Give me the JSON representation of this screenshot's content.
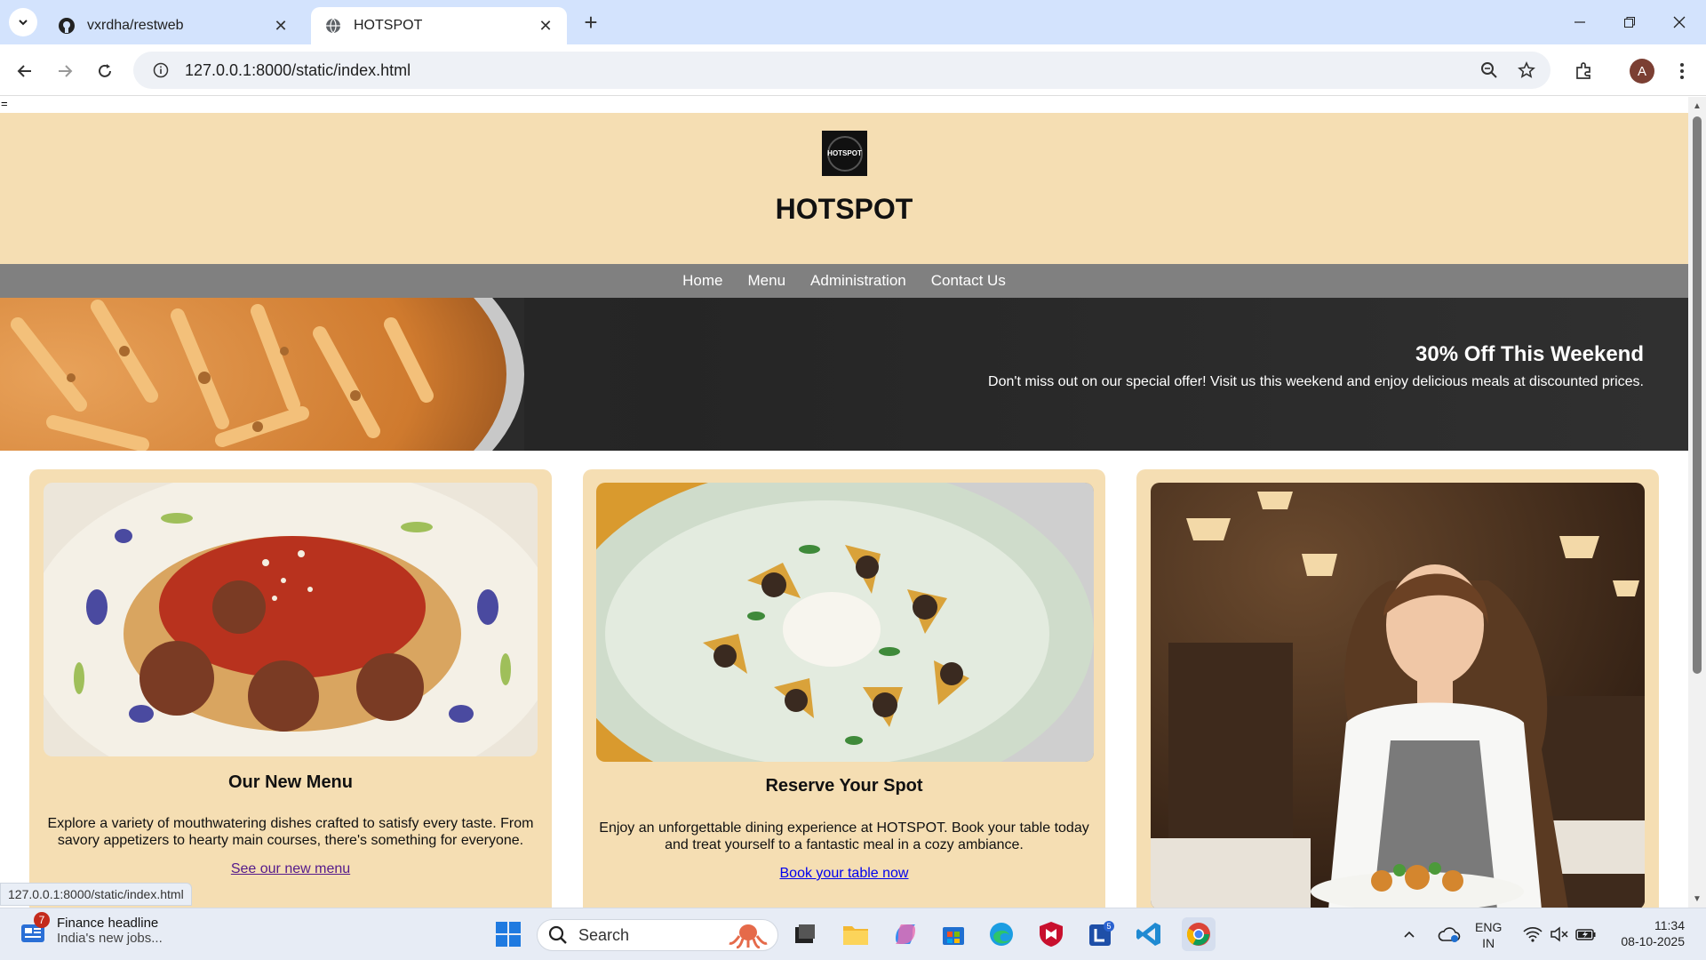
{
  "browser": {
    "tabs": [
      {
        "title": "vxrdha/restweb",
        "active": false
      },
      {
        "title": "HOTSPOT",
        "active": true
      }
    ],
    "url": "127.0.0.1:8000/static/index.html",
    "profile_initial": "A",
    "status_url": "127.0.0.1:8000/static/index.html"
  },
  "page": {
    "stray_char": "=",
    "logo_text": "HOTSPOT",
    "site_title": "HOTSPOT",
    "nav": [
      "Home",
      "Menu",
      "Administration",
      "Contact Us"
    ],
    "promo": {
      "title": "30% Off This Weekend",
      "text": "Don't miss out on our special offer! Visit us this weekend and enjoy delicious meals at discounted prices."
    },
    "cards": [
      {
        "title": "Our New Menu",
        "text": "Explore a variety of mouthwatering dishes crafted to satisfy every taste. From savory appetizers to hearty main courses, there's something for everyone.",
        "link": "See our new menu"
      },
      {
        "title": "Reserve Your Spot",
        "text": "Enjoy an unforgettable dining experience at HOTSPOT. Book your table today and treat yourself to a fantastic meal in a cozy ambiance.",
        "link": "Book your table now"
      },
      {
        "title": "",
        "text": "",
        "link": ""
      }
    ]
  },
  "taskbar": {
    "news_badge": "7",
    "news_title": "Finance headline",
    "news_sub": "India's new jobs...",
    "search_label": "Search",
    "store_badge": "5",
    "lang_line1": "ENG",
    "lang_line2": "IN",
    "time": "11:34",
    "date": "08-10-2025"
  },
  "colors": {
    "header_bg": "#f5deb3",
    "nav_bg": "#808080",
    "visited_link": "#551a8b",
    "link": "#0000ee"
  }
}
